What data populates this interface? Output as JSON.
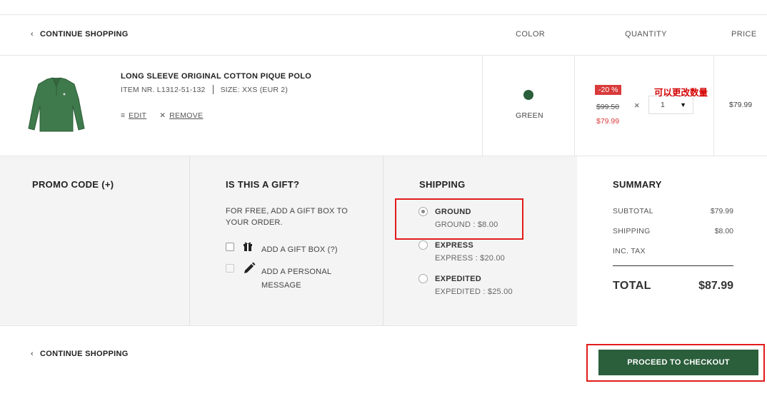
{
  "header": {
    "continue_label": "CONTINUE SHOPPING",
    "col_color": "COLOR",
    "col_quantity": "QUANTITY",
    "col_price": "PRICE"
  },
  "product": {
    "name": "LONG SLEEVE ORIGINAL COTTON PIQUE POLO",
    "item_nr": "ITEM NR. L1312-51-132",
    "size": "SIZE: XXS (EUR 2)",
    "edit_label": "EDIT",
    "remove_label": "REMOVE",
    "color_name": "GREEN",
    "color_hex": "#2b5e3b",
    "discount": "-20 %",
    "old_price": "$99.50",
    "new_price": "$79.99",
    "quantity": "1",
    "annotation": "可以更改数量",
    "row_price": "$79.99"
  },
  "promo": {
    "title": "PROMO CODE (+)"
  },
  "gift": {
    "title": "IS THIS A GIFT?",
    "desc_line1": "FOR FREE, ADD A GIFT BOX TO",
    "desc_line2": "YOUR ORDER.",
    "giftbox_label": "ADD A GIFT BOX (?)",
    "message_line1": "ADD A PERSONAL",
    "message_line2": "MESSAGE"
  },
  "shipping": {
    "title": "SHIPPING",
    "options": [
      {
        "name": "GROUND",
        "detail": "GROUND : $8.00",
        "selected": true
      },
      {
        "name": "EXPRESS",
        "detail": "EXPRESS : $20.00",
        "selected": false
      },
      {
        "name": "EXPEDITED",
        "detail": "EXPEDITED : $25.00",
        "selected": false
      }
    ]
  },
  "summary": {
    "title": "SUMMARY",
    "subtotal_label": "SUBTOTAL",
    "subtotal_value": "$79.99",
    "shipping_label": "SHIPPING",
    "shipping_value": "$8.00",
    "tax_label": "INC. TAX",
    "total_label": "TOTAL",
    "total_value": "$87.99"
  },
  "footer": {
    "continue_label": "CONTINUE SHOPPING",
    "checkout_label": "PROCEED TO CHECKOUT"
  },
  "colors": {
    "brand_green": "#2b5e3b",
    "sale_red": "#d93a3a",
    "highlight_red": "#e21b1b"
  }
}
